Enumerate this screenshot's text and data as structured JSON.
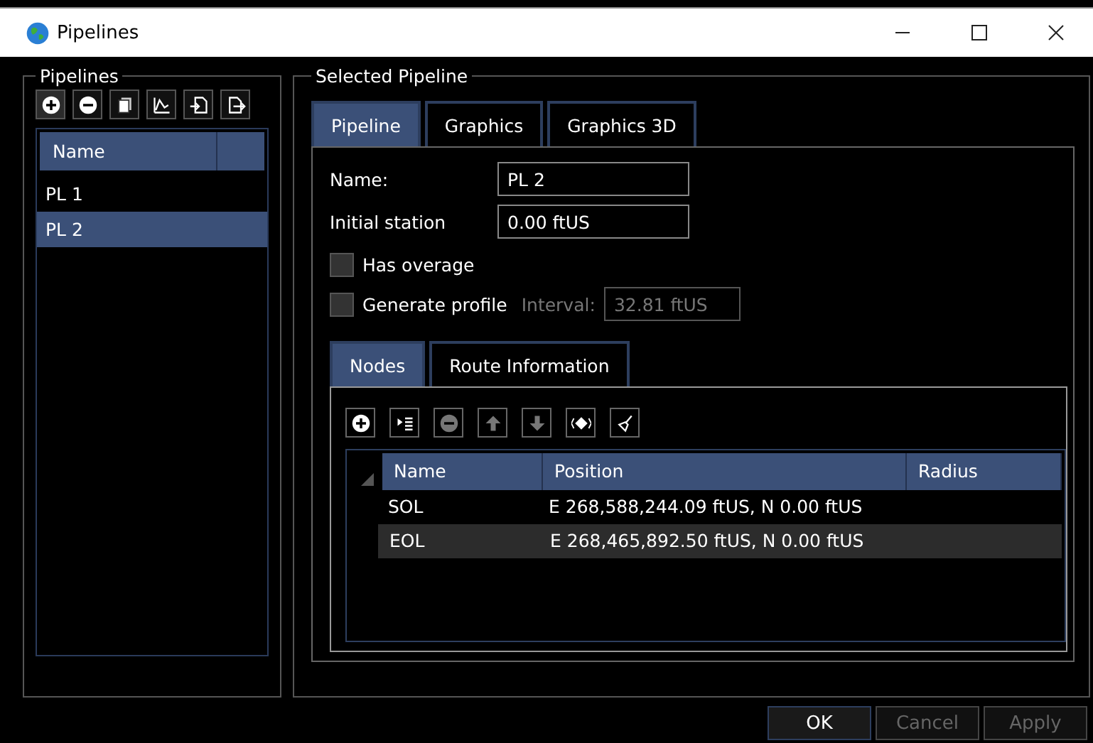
{
  "window": {
    "title": "Pipelines"
  },
  "pipelines_group": {
    "title": "Pipelines",
    "toolbar": [
      {
        "kind": "add"
      },
      {
        "kind": "remove"
      },
      {
        "kind": "copy"
      },
      {
        "kind": "profile"
      },
      {
        "kind": "import"
      },
      {
        "kind": "export"
      }
    ],
    "list": {
      "columns": [
        "Name"
      ],
      "items": [
        {
          "label": "PL 1",
          "selected": false
        },
        {
          "label": "PL 2",
          "selected": true
        }
      ]
    }
  },
  "selected_pipeline": {
    "title": "Selected Pipeline",
    "tabs": [
      {
        "label": "Pipeline",
        "selected": true
      },
      {
        "label": "Graphics",
        "selected": false
      },
      {
        "label": "Graphics 3D",
        "selected": false
      }
    ],
    "fields": [
      {
        "label": "Name:",
        "value": "PL 2"
      },
      {
        "label": "Initial station",
        "value": "0.00 ftUS"
      }
    ],
    "has_overage": {
      "label": "Has overage",
      "checked": false
    },
    "generate_profile": {
      "label": "Generate profile",
      "checked": false,
      "interval_label": "Interval:",
      "interval_value": "32.81 ftUS",
      "interval_disabled": true
    },
    "sub_tabs": [
      {
        "label": "Nodes",
        "selected": true
      },
      {
        "label": "Route Information",
        "selected": false
      }
    ],
    "node_toolbar": [
      {
        "kind": "add",
        "disabled": false
      },
      {
        "kind": "insert",
        "disabled": false
      },
      {
        "kind": "remove",
        "disabled": true
      },
      {
        "kind": "up",
        "disabled": true
      },
      {
        "kind": "down",
        "disabled": true
      },
      {
        "kind": "reverse",
        "disabled": false
      },
      {
        "kind": "clear",
        "disabled": false
      }
    ],
    "nodes_table": {
      "columns": [
        "Name",
        "Position",
        "Radius"
      ],
      "rows": [
        {
          "name": "SOL",
          "position": "E 268,588,244.09 ftUS, N 0.00 ftUS",
          "selected": false
        },
        {
          "name": "EOL",
          "position": "E 268,465,892.50 ftUS, N 0.00 ftUS",
          "selected": true
        }
      ]
    }
  },
  "buttons": [
    {
      "label": "OK",
      "disabled": false
    },
    {
      "label": "Cancel",
      "disabled": true
    },
    {
      "label": "Apply",
      "disabled": true
    }
  ]
}
